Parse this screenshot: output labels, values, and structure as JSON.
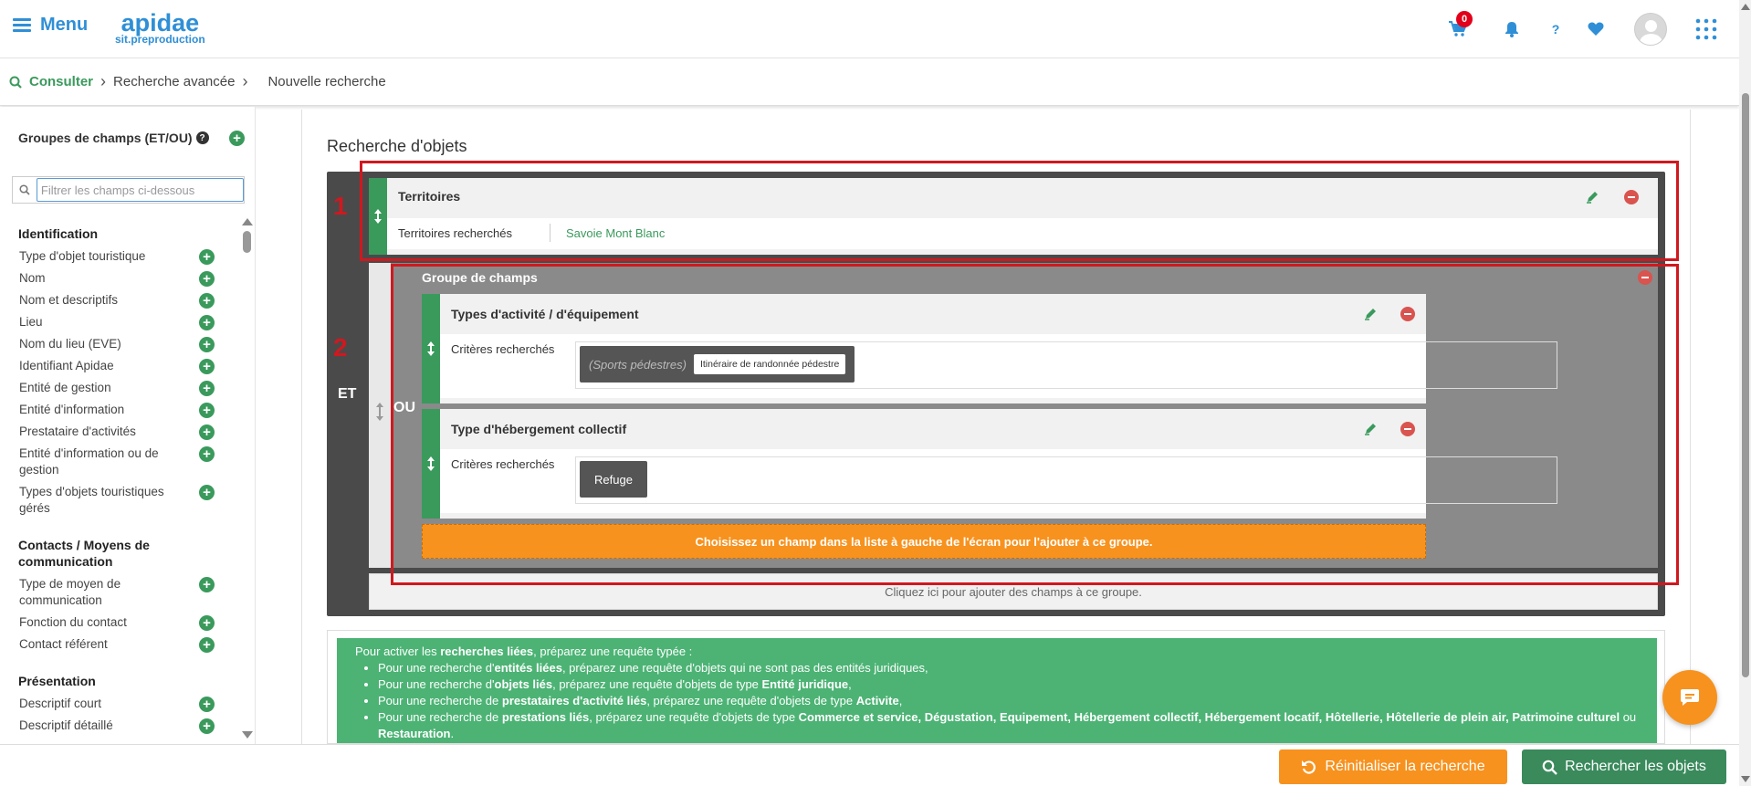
{
  "topbar": {
    "menu_label": "Menu",
    "logo_main": "apidae",
    "logo_sub": "sit.preproduction",
    "cart_count": "0",
    "help_label": "?"
  },
  "breadcrumb": {
    "root": "Consulter",
    "items": [
      "Recherche avancée",
      "Nouvelle recherche"
    ]
  },
  "sidebar": {
    "heading": "Groupes de champs (ET/OU)",
    "help": "?",
    "filter_placeholder": "Filtrer les champs ci-dessous",
    "groups": [
      {
        "title": "Identification",
        "items": [
          "Type d'objet touristique",
          "Nom",
          "Nom et descriptifs",
          "Lieu",
          "Nom du lieu (EVE)",
          "Identifiant Apidae",
          "Entité de gestion",
          "Entité d'information",
          "Prestataire d'activités",
          "Entité d'information ou de gestion",
          "Types d'objets touristiques gérés"
        ]
      },
      {
        "title": "Contacts / Moyens de communication",
        "items": [
          "Type de moyen de communication",
          "Fonction du contact",
          "Contact référent"
        ]
      },
      {
        "title": "Présentation",
        "items": [
          "Descriptif court",
          "Descriptif détaillé"
        ]
      }
    ]
  },
  "main": {
    "title": "Recherche d'objets",
    "et_label": "ET",
    "ou_label": "OU",
    "territoires": {
      "title": "Territoires",
      "row_label": "Territoires recherchés",
      "row_value": "Savoie Mont Blanc"
    },
    "group": {
      "title": "Groupe de champs",
      "activite": {
        "title": "Types d'activité / d'équipement",
        "row_label": "Critères recherchés",
        "tag_parent": "(Sports pédestres)",
        "tag_child": "Itinéraire de randonnée pédestre"
      },
      "hebergement": {
        "title": "Type d'hébergement collectif",
        "row_label": "Critères recherchés",
        "tag": "Refuge"
      },
      "orange_hint": "Choisissez un champ dans la liste à gauche de l'écran pour l'ajouter à ce groupe."
    },
    "add_hint": "Cliquez ici pour ajouter des champs à ce groupe.",
    "annotations": {
      "one": "1",
      "two": "2"
    }
  },
  "info": {
    "intro_pre": "Pour activer les ",
    "intro_bold": "recherches liées",
    "intro_post": ", préparez une requête typée :",
    "line1_pre": "Pour une recherche d'",
    "line1_bold": "entités liées",
    "line1_post": ", préparez une requête d'objets qui ne sont pas des entités juridiques,",
    "line2_pre": "Pour une recherche d'",
    "line2_bold": "objets liés",
    "line2_mid": ", préparez une requête d'objets de type ",
    "line2_bold2": "Entité juridique",
    "line2_post": ",",
    "line3_pre": "Pour une recherche de ",
    "line3_bold": "prestataires d'activité liés",
    "line3_mid": ", préparez une requête d'objets de type ",
    "line3_bold2": "Activite",
    "line3_post": ",",
    "line4_pre": "Pour une recherche de ",
    "line4_bold": "prestations liés",
    "line4_mid": ", préparez une requête d'objets de type ",
    "line4_types": "Commerce et service, Dégustation, Equipement, Hébergement collectif, Hébergement locatif, Hôtellerie, Hôtellerie de plein air, Patrimoine culturel",
    "line4_or": " ou ",
    "line4_last": "Restauration",
    "line4_post": "."
  },
  "buttons": {
    "reset": "Réinitialiser la recherche",
    "search": "Rechercher les objets"
  },
  "colors": {
    "brand_blue": "#2f8fd6",
    "green": "#3a9a5c",
    "orange": "#f7921e",
    "danger": "#d9534f",
    "annotation_red": "#d0181f"
  }
}
